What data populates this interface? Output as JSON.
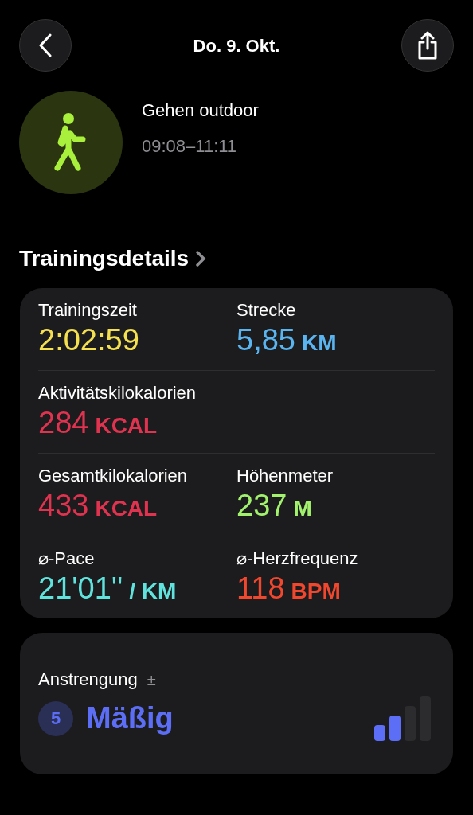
{
  "header": {
    "title": "Do. 9. Okt."
  },
  "workout": {
    "name": "Gehen outdoor",
    "time": "09:08–11:11"
  },
  "section": {
    "title": "Trainingsdetails"
  },
  "metric_rows": [
    [
      {
        "label": "Trainingszeit",
        "value": "2:02:59",
        "color": "#f5e050"
      },
      {
        "label": "Strecke",
        "value": "5,85",
        "unit": "KM",
        "color": "#5ab4f0"
      }
    ],
    [
      {
        "label": "Aktivitätskilokalorien",
        "value": "284",
        "unit": "KCAL",
        "color": "#e0334f"
      }
    ],
    [
      {
        "label": "Gesamtkilokalorien",
        "value": "433",
        "unit": "KCAL",
        "color": "#e0334f"
      },
      {
        "label": "Höhenmeter",
        "value": "237",
        "unit": "M",
        "color": "#a2f26e"
      }
    ],
    [
      {
        "label": "⌀-Pace",
        "value": "21'01''",
        "unit": "/ KM",
        "color": "#5fe3dc"
      },
      {
        "label": "⌀-Herzfrequenz",
        "value": "118",
        "unit": "BPM",
        "color": "#f0472f"
      }
    ]
  ],
  "effort": {
    "label": "Anstrengung",
    "symbol": "±",
    "score": "5",
    "rating": "Mäßig",
    "level": 0.5
  }
}
